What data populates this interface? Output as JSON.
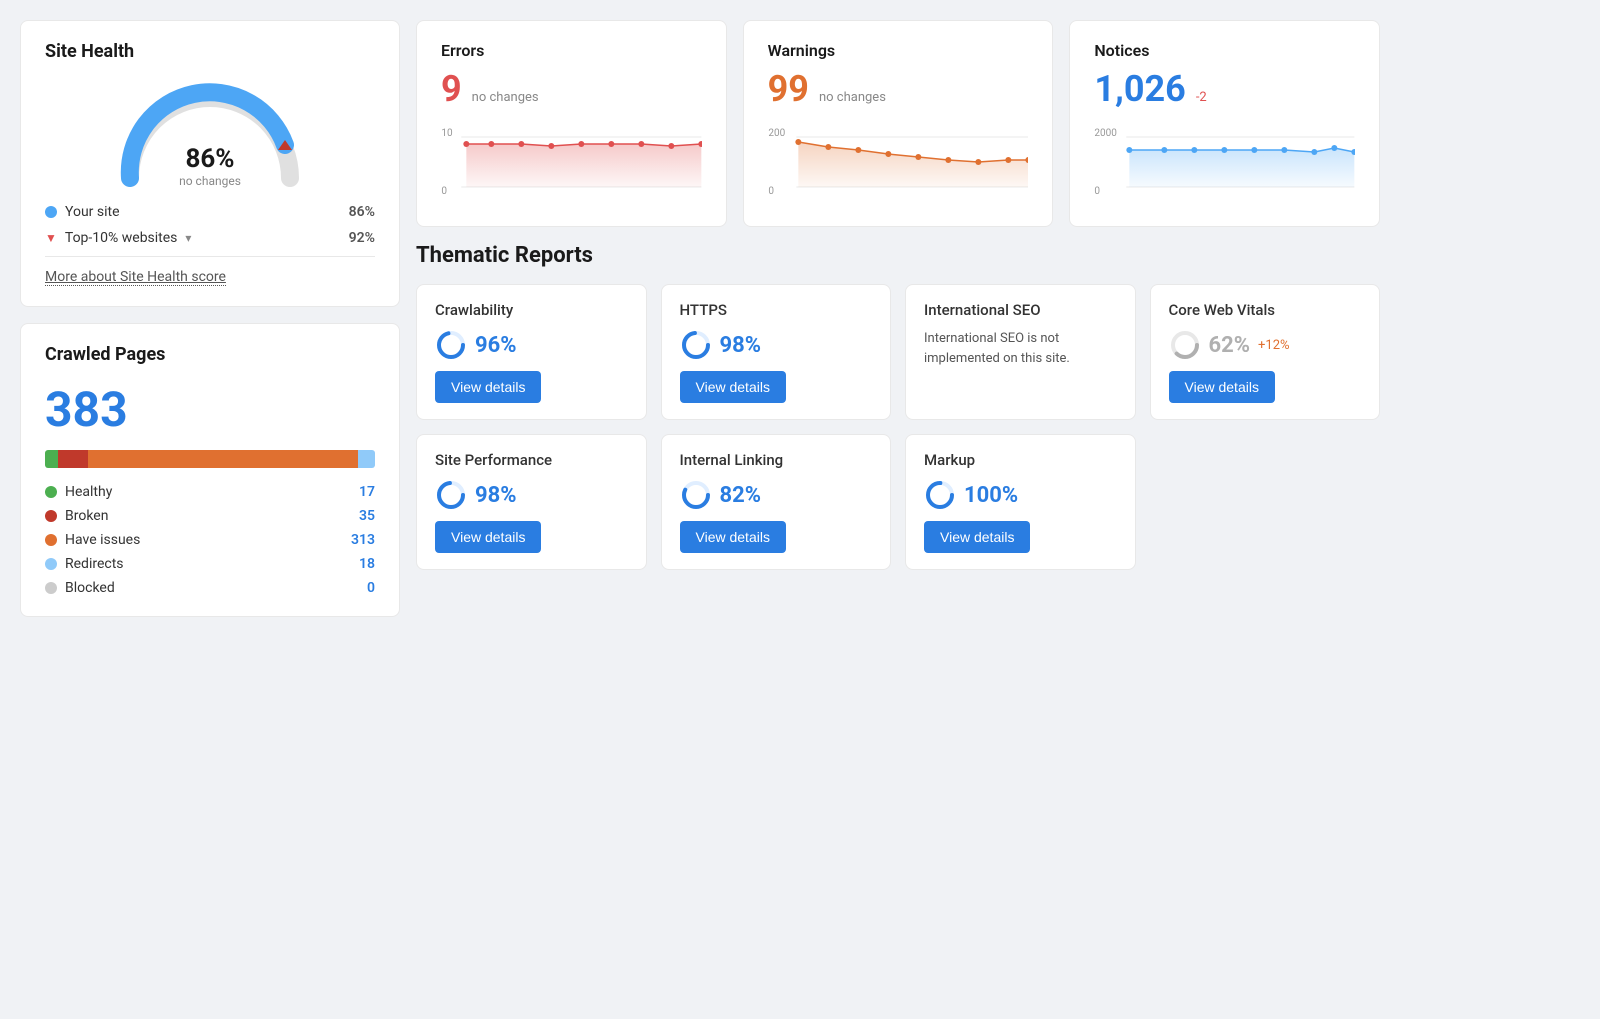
{
  "site_health": {
    "title": "Site Health",
    "percent": "86%",
    "subtext": "no changes",
    "your_site_label": "Your site",
    "your_site_value": "86%",
    "top10_label": "Top-10% websites",
    "top10_value": "92%",
    "more_link": "More about Site Health score",
    "gauge_value": 86
  },
  "crawled_pages": {
    "title": "Crawled Pages",
    "count": "383",
    "legend": [
      {
        "label": "Healthy",
        "value": "17",
        "color": "#4caf50",
        "width_pct": 4
      },
      {
        "label": "Broken",
        "value": "35",
        "color": "#c0392b",
        "width_pct": 9
      },
      {
        "label": "Have issues",
        "value": "313",
        "color": "#e07030",
        "width_pct": 82
      },
      {
        "label": "Redirects",
        "value": "18",
        "color": "#90caf9",
        "width_pct": 5
      },
      {
        "label": "Blocked",
        "value": "0",
        "color": "#ccc",
        "width_pct": 0
      }
    ]
  },
  "metrics": {
    "errors": {
      "label": "Errors",
      "value": "9",
      "change": "no changes"
    },
    "warnings": {
      "label": "Warnings",
      "value": "99",
      "change": "no changes"
    },
    "notices": {
      "label": "Notices",
      "value": "1,026",
      "change": "-2"
    }
  },
  "thematic_reports": {
    "title": "Thematic Reports",
    "row1": [
      {
        "name": "Crawlability",
        "score": "96%",
        "score_type": "blue",
        "score_num": 96,
        "has_button": true,
        "button_label": "View details"
      },
      {
        "name": "HTTPS",
        "score": "98%",
        "score_type": "blue",
        "score_num": 98,
        "has_button": true,
        "button_label": "View details"
      },
      {
        "name": "International SEO",
        "score": "",
        "score_type": "none",
        "score_num": 0,
        "has_button": false,
        "desc": "International SEO is not implemented on this site.",
        "button_label": ""
      },
      {
        "name": "Core Web Vitals",
        "score": "62%",
        "score_change": "+12%",
        "score_type": "gray",
        "score_num": 62,
        "has_button": true,
        "button_label": "View details"
      }
    ],
    "row2": [
      {
        "name": "Site Performance",
        "score": "98%",
        "score_type": "blue",
        "score_num": 98,
        "has_button": true,
        "button_label": "View details"
      },
      {
        "name": "Internal Linking",
        "score": "82%",
        "score_type": "blue",
        "score_num": 82,
        "has_button": true,
        "button_label": "View details"
      },
      {
        "name": "Markup",
        "score": "100%",
        "score_type": "blue",
        "score_num": 100,
        "has_button": true,
        "button_label": "View details"
      },
      {
        "name": "",
        "empty": true
      }
    ]
  }
}
